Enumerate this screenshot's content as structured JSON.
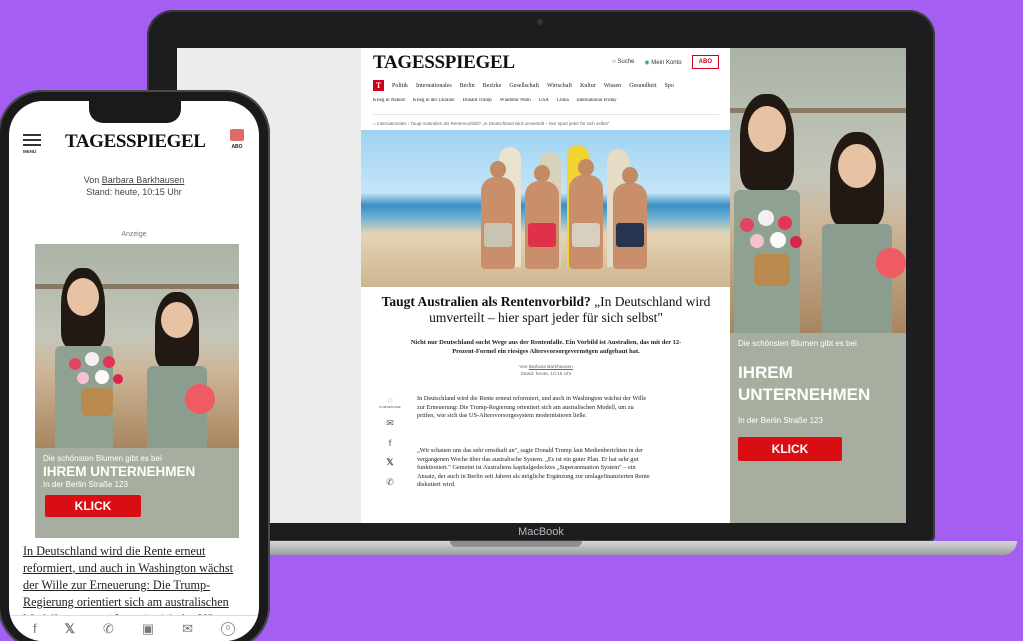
{
  "laptop": {
    "brand": "MacBook",
    "site": {
      "logo": "TAGESSPIEGEL",
      "search": "Suche",
      "login": "Mein Konto",
      "abo": "ABO",
      "nav_primary": [
        "Politik",
        "Internationales",
        "Berlin",
        "Bezirke",
        "Gesellschaft",
        "Wirtschaft",
        "Kultur",
        "Wissen",
        "Gesundheit",
        "Spo"
      ],
      "nav_secondary": [
        "Krieg in Nahost",
        "Krieg in der Ukraine",
        "Donald Trump",
        "Wladimir Putin",
        "USA",
        "China",
        "International Friday"
      ],
      "breadcrumb": "Internationales  ›  Taugt Australien als Rentenvorbild? „In Deutschland wird umverteilt – hier spart jeder für sich selbst\""
    },
    "article": {
      "headline_bold": "Taugt Australien als Rentenvorbild?",
      "headline_rest": "„In Deutschland wird umverteilt – hier spart jeder für sich selbst\"",
      "teaser": "Nicht nur Deutschland sucht Wege aus der Rentenfalle. Ein Vorbild ist Australien, das mit der 12-Prozent-Formel ein riesiges Altersvorsorgevermögen aufgebaut hat.",
      "by_prefix": "Von",
      "author": "Barbara Barkhausen",
      "stand": "Stand: heute, 10:15 Uhr",
      "share_label": "KOMMENTARE",
      "para1": "In Deutschland wird die Rente erneut reformiert, und auch in Washington wächst der Wille zur Erneuerung: Die Trump-Regierung orientiert sich am australischen Modell, um zu prüfen, wie sich das US-Altersvorsorgesystem modernisieren ließe.",
      "para2": "„Wir schauen uns das sehr ernsthaft an\", sagte Donald Trump laut Medienberichten in der vergangenen Woche über das australische System. „Es ist ein guter Plan. Er hat sehr gut funktioniert.\" Gemeint ist Australiens kapitalgedecktes „Superannuation System\" – ein Ansatz, der auch in Berlin seit Jahren als mögliche Ergänzung zur umlagefinanzierten Rente diskutiert wird."
    },
    "ad": {
      "line1": "Die schönsten Blumen gibt es bei",
      "headline": "IHREM UNTERNEHMEN",
      "address": "In der Berlin Straße 123",
      "cta": "KLICK"
    }
  },
  "phone": {
    "menu_label": "MENÜ",
    "logo": "TAGESSPIEGEL",
    "abo": "ABO",
    "by_prefix": "Von",
    "author": "Barbara Barkhausen",
    "stand": "Stand: heute, 10:15 Uhr",
    "anzeige": "Anzeige",
    "ad": {
      "line1": "Die schönsten Blumen gibt es bei",
      "headline": "IHREM UNTERNEHMEN",
      "address": "In der Berlin Straße 123",
      "cta": "KLICK"
    },
    "text_link": "In Deutschland wird die Rente erneut reformiert",
    "text_rest": ", und auch in Washington wächst der Wille zur Erneuerung: Die Trump-Regierung orientiert sich am australischen Modell, um zu prüfen, wie sich das US-",
    "comment_count": "0"
  },
  "colors": {
    "background": "#a45ff2",
    "brand_red": "#d0021b",
    "ad_bg": "#a7ae9f",
    "cta": "#d80e14"
  }
}
